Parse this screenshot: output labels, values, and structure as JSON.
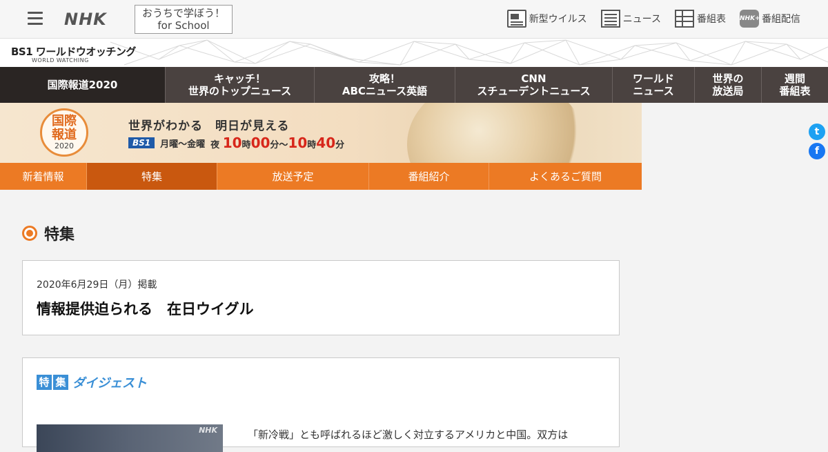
{
  "header": {
    "logo": "NHK",
    "school_line1": "おうちで学ぼう！",
    "school_line2": "for School",
    "links": [
      {
        "label": "新型ウイルス",
        "icon": "virus-news-icon"
      },
      {
        "label": "ニュース",
        "icon": "news-icon"
      },
      {
        "label": "番組表",
        "icon": "program-guide-icon"
      },
      {
        "label": "番組配信",
        "icon": "nhk-plus-icon",
        "icon_text": "NHK+"
      }
    ]
  },
  "band": {
    "logo_main": "BS1 ワールドウオッチング",
    "logo_sub": "WORLD WATCHING"
  },
  "program_nav": [
    {
      "label": "国際報道2020",
      "active": true
    },
    {
      "label": "キャッチ！\n世界のトップニュース",
      "active": false
    },
    {
      "label": "攻略！\nABCニュース英語",
      "active": false
    },
    {
      "label": "CNN\nスチューデントニュース",
      "active": false
    },
    {
      "label": "ワールド\nニュース",
      "active": false
    },
    {
      "label": "世界の\n放送局",
      "active": false
    },
    {
      "label": "週間\n番組表",
      "active": false
    }
  ],
  "hero": {
    "emblem_line1": "国際",
    "emblem_line2": "報道",
    "emblem_year": "2020",
    "tagline": "世界がわかる　明日が見える",
    "channel": "BS1",
    "days": "月曜～金曜",
    "night": "夜",
    "h1": "10",
    "ji1": "時",
    "m1": "00",
    "fun1": "分～",
    "h2": "10",
    "ji2": "時",
    "m2": "40",
    "fun2": "分"
  },
  "sub_nav": [
    {
      "label": "新着情報",
      "active": false
    },
    {
      "label": "特集",
      "active": true
    },
    {
      "label": "放送予定",
      "active": false
    },
    {
      "label": "番組紹介",
      "active": false
    },
    {
      "label": "よくあるご質問",
      "active": false
    }
  ],
  "social": {
    "twitter": "t",
    "facebook": "f"
  },
  "section": {
    "title": "特集"
  },
  "article": {
    "date": "2020年6月29日（月）掲載",
    "title": "情報提供迫られる　在日ウイグル"
  },
  "digest": {
    "box1": "特",
    "box2": "集",
    "label": "ダイジェスト",
    "thumb_logo": "NHK",
    "text": "「新冷戦」とも呼ばれるほど激しく対立するアメリカと中国。双方は"
  },
  "colors": {
    "orange": "#ec7a24",
    "orange_active": "#c9580f",
    "dark_nav": "#4a4240",
    "digest_blue": "#3a8fd6",
    "time_red": "#d7261a"
  }
}
